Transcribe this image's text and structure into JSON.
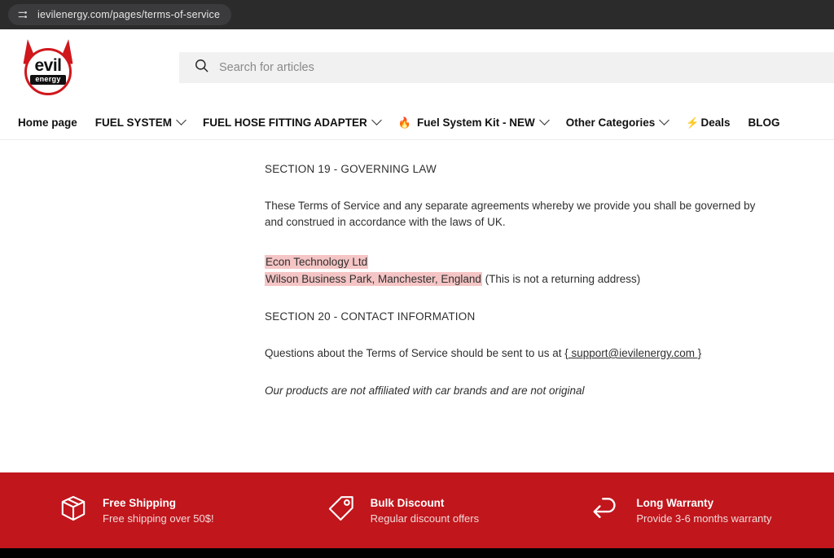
{
  "browser": {
    "url": "ievilenergy.com/pages/terms-of-service",
    "url_icon": "page-settings-icon"
  },
  "header": {
    "logo": {
      "word_top": "evil",
      "word_bottom": "energy",
      "icon": "evil-energy-logo"
    },
    "search": {
      "placeholder": "Search for articles",
      "value": "",
      "icon": "search-icon"
    }
  },
  "nav": {
    "items": [
      {
        "label": "Home page",
        "emoji": "",
        "has_dropdown": false
      },
      {
        "label": "FUEL SYSTEM",
        "emoji": "",
        "has_dropdown": true
      },
      {
        "label": "FUEL HOSE FITTING ADAPTER",
        "emoji": "",
        "has_dropdown": true
      },
      {
        "label": "Fuel System Kit - NEW",
        "emoji": "🔥",
        "has_dropdown": true
      },
      {
        "label": "Other Categories",
        "emoji": "",
        "has_dropdown": true
      },
      {
        "label": "Deals",
        "emoji": "⚡",
        "has_dropdown": false
      },
      {
        "label": "BLOG",
        "emoji": "",
        "has_dropdown": false
      }
    ]
  },
  "main": {
    "section19_title": "SECTION 19 - GOVERNING LAW",
    "section19_body": "These Terms of Service and any separate agreements whereby we provide you shall be governed by and construed in accordance with the laws of UK.",
    "company_name": "Econ Technology Ltd",
    "company_address": "Wilson Business Park, Manchester, England",
    "address_note": "(This is not a returning address)",
    "section20_title": "SECTION 20 - CONTACT INFORMATION",
    "section20_prefix": "Questions about the Terms of Service should be sent to us at",
    "section20_email": "{ support@ievilenergy.com }",
    "disclaimer": "Our products are not affiliated with car brands and are not original"
  },
  "footer": {
    "features": [
      {
        "title": "Free Shipping",
        "subtitle": "Free shipping over 50$!",
        "icon": "box-icon"
      },
      {
        "title": "Bulk Discount",
        "subtitle": "Regular discount offers",
        "icon": "tag-icon"
      },
      {
        "title": "Long Warranty",
        "subtitle": "Provide 3-6 months warranty",
        "icon": "return-arrow-icon"
      }
    ]
  },
  "colors": {
    "brand_red": "#c0161c",
    "logo_red": "#d0171c",
    "highlight_pink": "#f5c5c5",
    "chrome_dark": "#2b2b2b"
  }
}
